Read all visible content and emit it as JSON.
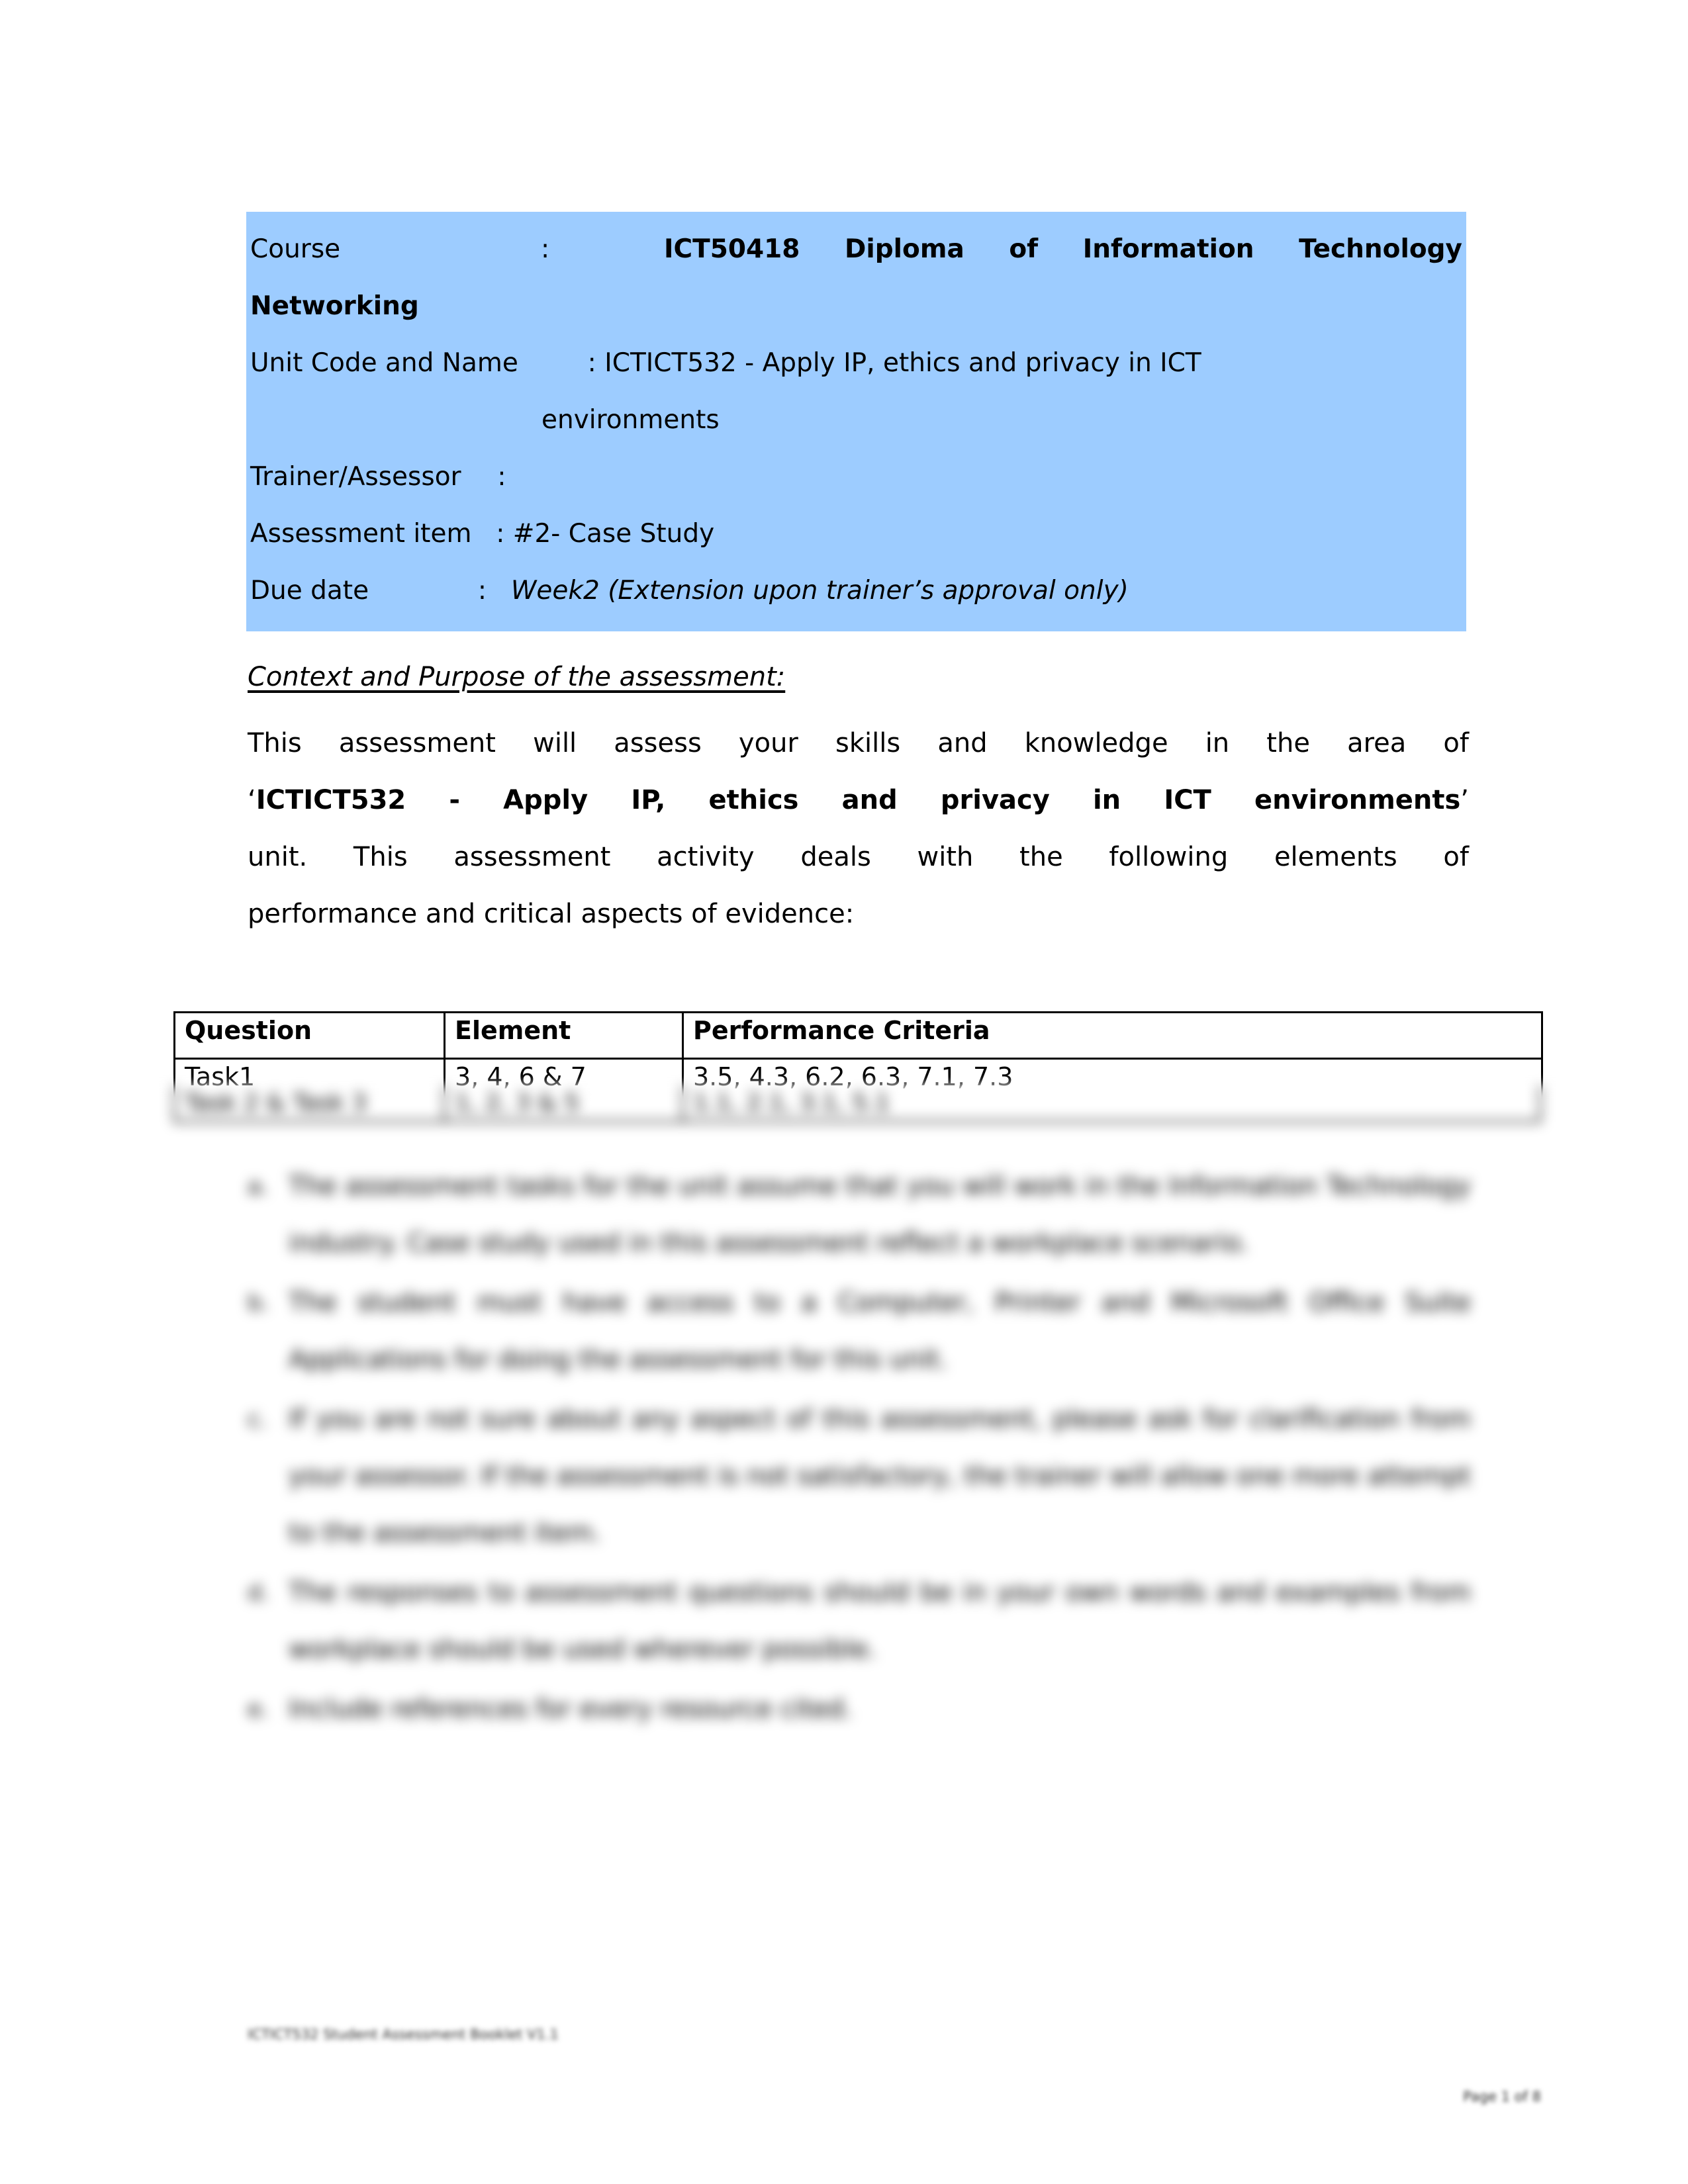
{
  "document": {
    "header_block": {
      "background_color": "#9DCCFF",
      "rows": [
        {
          "label": "Course",
          "separator": ":",
          "value_bold": "ICT50418 Diploma of Information Technology Networking"
        },
        {
          "label": "Unit Code and Name",
          "separator": ":",
          "value": "ICTICT532 - Apply IP, ethics and privacy in ICT",
          "value_continuation": "environments"
        },
        {
          "label": "Trainer/Assessor",
          "separator": ":",
          "value": ""
        },
        {
          "label": "Assessment item",
          "separator": ":",
          "value": "#2- Case Study"
        },
        {
          "label": "Due date",
          "separator": ":",
          "value_italic": "Week2 (Extension upon trainer’s approval only)"
        }
      ],
      "course_label": "Course",
      "course_colon": ":",
      "course_value_line1": "ICT50418   Diploma   of   Information   Technology",
      "course_value_line2": "Networking",
      "unit_label": "Unit Code and Name",
      "unit_value": ": ICTICT532 - Apply IP, ethics and privacy in ICT",
      "unit_value_cont": "environments",
      "trainer_label": "Trainer/Assessor",
      "trainer_value": ":",
      "assessment_label": "Assessment item",
      "assessment_value": ": #2- Case Study",
      "duedate_label": "Due date",
      "duedate_colon": ":",
      "duedate_value": "Week2 (Extension upon trainer’s approval only)"
    },
    "context_heading": "Context and Purpose of the assessment:",
    "body_paragraph": {
      "line1": "This assessment will assess your skills and knowledge in the area of",
      "quote_open": "‘",
      "unit_name_bold": "ICTICT532 - Apply IP, ethics and privacy in ICT environments",
      "quote_close": "’",
      "line3": "unit. This assessment activity deals with the following elements of",
      "line4": "performance and critical aspects of evidence:"
    },
    "criteria_table": {
      "headers": [
        "Question",
        "Element",
        "Performance Criteria"
      ],
      "rows": [
        {
          "question": "Task1",
          "element": "3, 4, 6 & 7",
          "criteria": "3.5, 4.3, 6.2, 6.3, 7.1, 7.3"
        },
        {
          "question": "Task 2 & Task 3",
          "element": "1, 2, 3 & 5",
          "criteria": "1.1, 2.1, 3.1, 5.1"
        }
      ]
    },
    "instructions_list": {
      "items": [
        "The assessment tasks for the unit assume that you will work in the Information Technology industry. Case study used in this assessment reflect a workplace scenario.",
        "The student must have access to a Computer, Printer and Microsoft Office Suite Applications for doing the assessment for this unit.",
        "If you are not sure about any aspect of this assessment, please ask for clarification from your assessor. If the assessment is not satisfactory, the trainer will allow one more attempt to the assessment item.",
        "The responses to assessment questions should be in your own words and examples from workplace should be used wherever possible.",
        "Include references for every resource cited."
      ],
      "markers": [
        "a.",
        "b.",
        "c.",
        "d.",
        "e."
      ]
    },
    "footer": {
      "left_text": "ICTICT532 Student Assessment Booklet V1.1",
      "page_number": "Page 1 of 8"
    }
  }
}
